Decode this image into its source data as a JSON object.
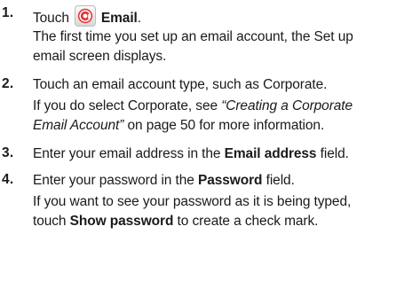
{
  "steps": [
    {
      "number": "1.",
      "parts": [
        {
          "text": "Touch"
        },
        {
          "icon": "email-app-icon"
        },
        {
          "text": "Email",
          "style": "bold"
        },
        {
          "text": "."
        }
      ],
      "lines": [
        "The first time you set up an email account, the Set up",
        "email screen displays."
      ]
    },
    {
      "number": "2.",
      "first_line": "Touch an email account type, such as Corporate.",
      "l2_a": "If you do select Corporate, see ",
      "l2_b": "“Creating a Corporate",
      "l3_a": "Email Account”",
      "l3_b": " on page 50 for more information."
    },
    {
      "number": "3.",
      "a": "Enter your email address in the ",
      "b": "Email address",
      "c": " field."
    },
    {
      "number": "4.",
      "a": "Enter your password in the ",
      "b": "Password",
      "c": " field.",
      "l2": "If you want to see your password as it is being typed,",
      "l3_a": "touch ",
      "l3_b": "Show password",
      "l3_c": " to create a check mark."
    }
  ],
  "colors": {
    "icon_red": "#e8353a",
    "text": "#1a1a1a"
  }
}
